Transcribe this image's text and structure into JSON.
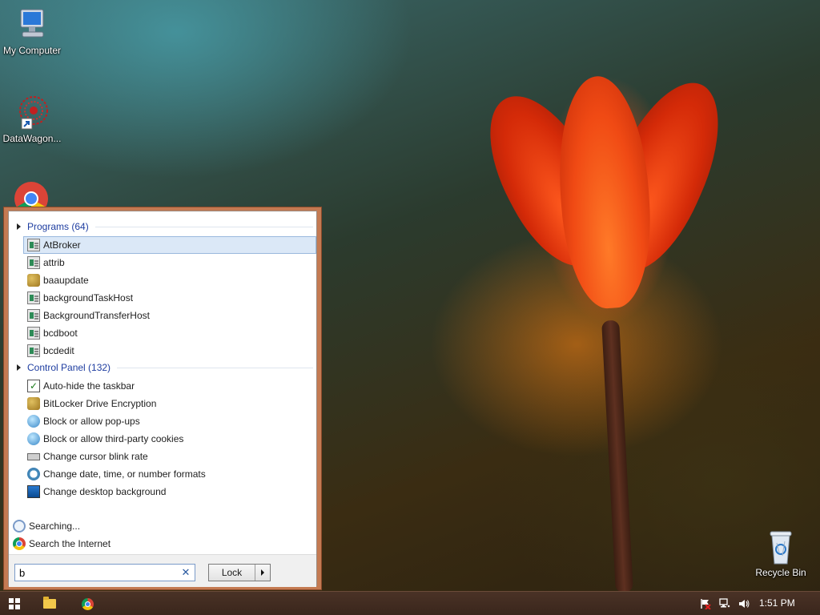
{
  "desktop": {
    "icons": [
      {
        "label": "My Computer",
        "icon": "computer-icon"
      },
      {
        "label": "DataWagon...",
        "icon": "datawagon-shortcut-icon"
      },
      {
        "label": "",
        "icon": "chrome-icon"
      },
      {
        "label": "Recycle Bin",
        "icon": "recycle-bin-icon"
      }
    ]
  },
  "search_popup": {
    "programs_header": "Programs (64)",
    "programs": [
      {
        "label": "AtBroker",
        "icon": "app-window-icon",
        "selected": true
      },
      {
        "label": "attrib",
        "icon": "app-window-icon"
      },
      {
        "label": "baaupdate",
        "icon": "keys-icon"
      },
      {
        "label": "backgroundTaskHost",
        "icon": "app-window-icon"
      },
      {
        "label": "BackgroundTransferHost",
        "icon": "app-window-icon"
      },
      {
        "label": "bcdboot",
        "icon": "app-window-icon"
      },
      {
        "label": "bcdedit",
        "icon": "app-window-icon"
      }
    ],
    "control_panel_header": "Control Panel (132)",
    "control_panel": [
      {
        "label": "Auto-hide the taskbar",
        "icon": "checkbox-icon"
      },
      {
        "label": "BitLocker Drive Encryption",
        "icon": "keys-icon"
      },
      {
        "label": "Block or allow pop-ups",
        "icon": "globe-icon"
      },
      {
        "label": "Block or allow third-party cookies",
        "icon": "globe-icon"
      },
      {
        "label": "Change cursor blink rate",
        "icon": "keyboard-icon"
      },
      {
        "label": "Change date, time, or number formats",
        "icon": "clock-globe-icon"
      },
      {
        "label": "Change desktop background",
        "icon": "monitor-icon"
      }
    ],
    "searching_label": "Searching...",
    "search_internet_label": "Search the Internet",
    "search_value": "b",
    "lock_button_label": "Lock"
  },
  "taskbar": {
    "clock": "1:51 PM",
    "tray_icons": [
      "action-center-flag-icon",
      "network-icon",
      "volume-icon"
    ]
  }
}
